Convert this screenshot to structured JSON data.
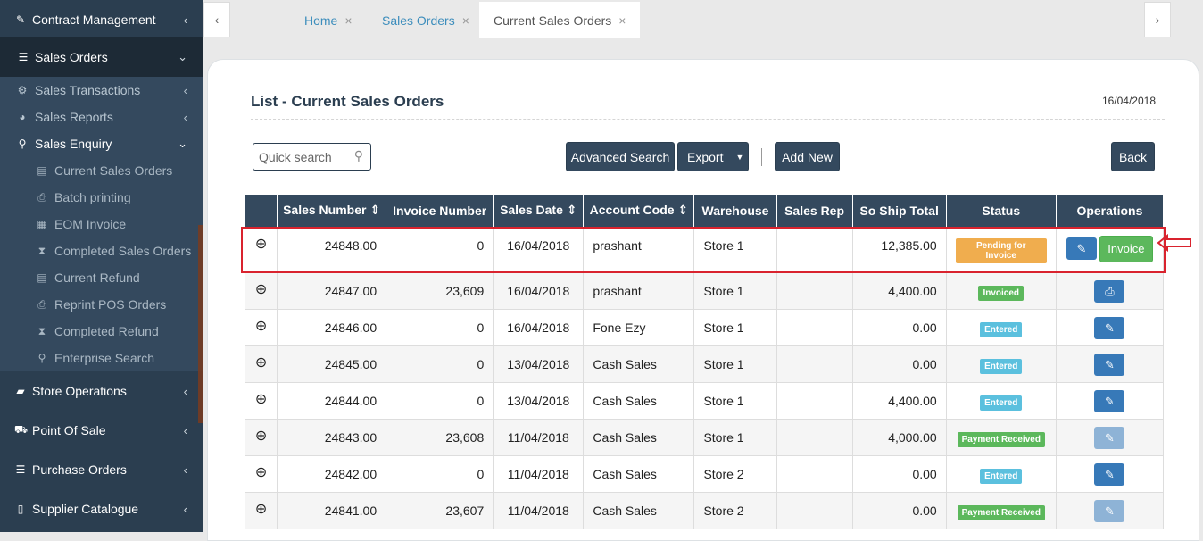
{
  "sidebar": {
    "contract_management": "Contract Management",
    "sales_orders": "Sales Orders",
    "sales_transactions": "Sales Transactions",
    "sales_reports": "Sales Reports",
    "sales_enquiry": "Sales Enquiry",
    "sub_items": [
      "Current Sales Orders",
      "Batch printing",
      "EOM Invoice",
      "Completed Sales Orders",
      "Current Refund",
      "Reprint POS Orders",
      "Completed Refund",
      "Enterprise Search"
    ],
    "store_operations": "Store Operations",
    "point_of_sale": "Point Of Sale",
    "purchase_orders": "Purchase Orders",
    "supplier_catalogue": "Supplier Catalogue"
  },
  "tabs": [
    "Home",
    "Sales Orders",
    "Current Sales Orders"
  ],
  "page": {
    "title": "List - Current Sales Orders",
    "date": "16/04/2018",
    "search_placeholder": "Quick search"
  },
  "buttons": {
    "advanced_search": "Advanced Search",
    "export": "Export",
    "add_new": "Add New",
    "back": "Back"
  },
  "table": {
    "headers": [
      "Sales Number",
      "Invoice Number",
      "Sales Date",
      "Account Code",
      "Warehouse",
      "Sales Rep",
      "So Ship Total",
      "Status",
      "Operations"
    ],
    "rows": [
      {
        "sales_number": "24848.00",
        "invoice_number": "0",
        "sales_date": "16/04/2018",
        "account_code": "prashant",
        "warehouse": "Store 1",
        "sales_rep": "",
        "total": "12,385.00",
        "status": "Pending for Invoice",
        "invoice_btn": "Invoice"
      },
      {
        "sales_number": "24847.00",
        "invoice_number": "23,609",
        "sales_date": "16/04/2018",
        "account_code": "prashant",
        "warehouse": "Store 1",
        "sales_rep": "",
        "total": "4,400.00",
        "status": "Invoiced"
      },
      {
        "sales_number": "24846.00",
        "invoice_number": "0",
        "sales_date": "16/04/2018",
        "account_code": "Fone Ezy",
        "warehouse": "Store 1",
        "sales_rep": "",
        "total": "0.00",
        "status": "Entered"
      },
      {
        "sales_number": "24845.00",
        "invoice_number": "0",
        "sales_date": "13/04/2018",
        "account_code": "Cash Sales",
        "warehouse": "Store 1",
        "sales_rep": "",
        "total": "0.00",
        "status": "Entered"
      },
      {
        "sales_number": "24844.00",
        "invoice_number": "0",
        "sales_date": "13/04/2018",
        "account_code": "Cash Sales",
        "warehouse": "Store 1",
        "sales_rep": "",
        "total": "4,400.00",
        "status": "Entered"
      },
      {
        "sales_number": "24843.00",
        "invoice_number": "23,608",
        "sales_date": "11/04/2018",
        "account_code": "Cash Sales",
        "warehouse": "Store 1",
        "sales_rep": "",
        "total": "4,000.00",
        "status": "Payment Received"
      },
      {
        "sales_number": "24842.00",
        "invoice_number": "0",
        "sales_date": "11/04/2018",
        "account_code": "Cash Sales",
        "warehouse": "Store 2",
        "sales_rep": "",
        "total": "0.00",
        "status": "Entered"
      },
      {
        "sales_number": "24841.00",
        "invoice_number": "23,607",
        "sales_date": "11/04/2018",
        "account_code": "Cash Sales",
        "warehouse": "Store 2",
        "sales_rep": "",
        "total": "0.00",
        "status": "Payment Received"
      }
    ]
  },
  "colors": {
    "sidebar": "#2b3e50",
    "header": "#34495e",
    "pending": "#f0ad4e",
    "invoiced": "#5cb85c",
    "entered": "#5bc0de",
    "payment_received": "#5cb85c",
    "highlight": "#d9232e"
  }
}
